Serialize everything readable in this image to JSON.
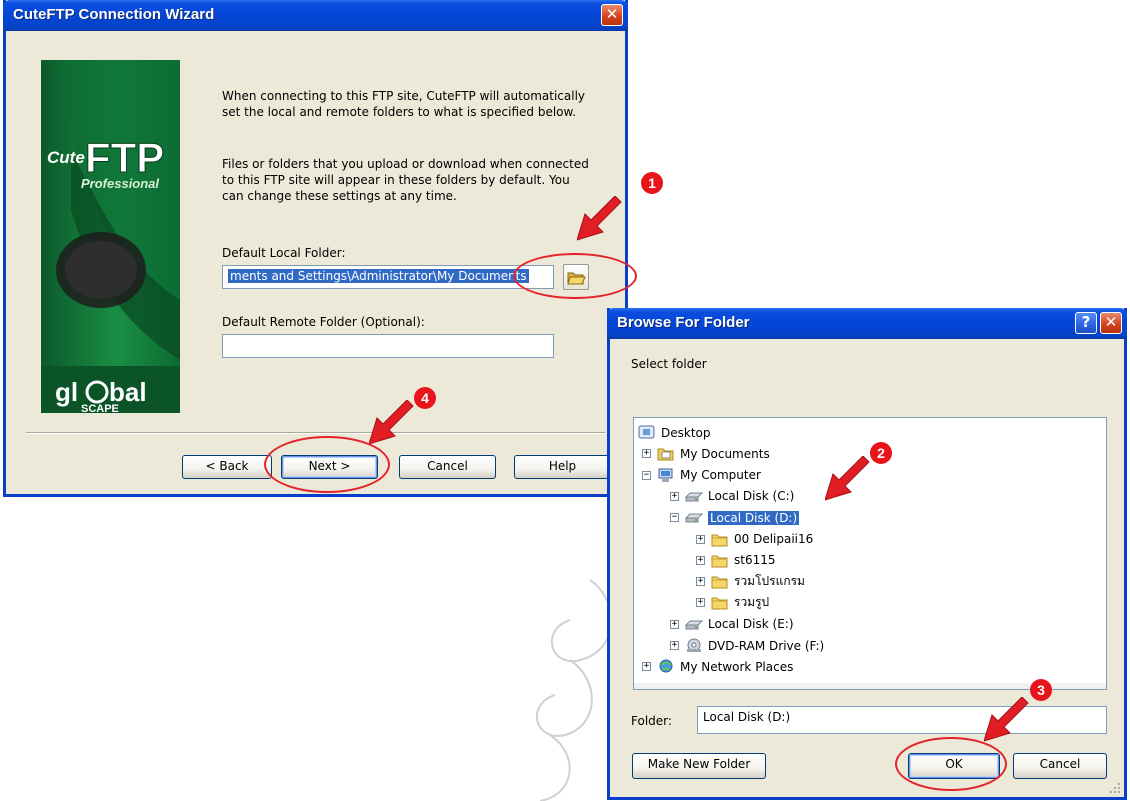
{
  "wizard": {
    "title": "CuteFTP Connection Wizard",
    "close_glyph": "✕",
    "logo_brand": "CuteFTP Professional",
    "logo_vendor": "globalSCAPE",
    "intro_para1": "When connecting to this FTP site, CuteFTP will automatically set the local and remote folders to what is specified below.",
    "intro_para2": "Files or folders that you upload or download when connected to this FTP site will appear in these folders by default. You can change these settings at any time.",
    "local_folder_label": "Default Local Folder:",
    "local_folder_value": "ments and Settings\\Administrator\\My Documents",
    "remote_folder_label": "Default Remote Folder (Optional):",
    "remote_folder_value": "",
    "buttons": {
      "back": "< Back",
      "next": "Next >",
      "cancel": "Cancel",
      "help": "Help"
    }
  },
  "browse": {
    "title": "Browse For Folder",
    "help_glyph": "?",
    "close_glyph": "✕",
    "prompt": "Select folder",
    "tree": [
      {
        "label": "Desktop",
        "icon": "desktop-icon"
      },
      {
        "label": "My Documents",
        "icon": "folder-docs-icon",
        "expander": "+"
      },
      {
        "label": "My Computer",
        "icon": "computer-icon",
        "expander": "−"
      },
      {
        "label": "Local Disk (C:)",
        "icon": "drive-icon",
        "expander": "+"
      },
      {
        "label": "Local Disk (D:)",
        "icon": "drive-icon",
        "expander": "−",
        "selected": true
      },
      {
        "label": "00 Delipaii16",
        "icon": "folder-icon",
        "expander": "+"
      },
      {
        "label": "st6115",
        "icon": "folder-icon",
        "expander": "+"
      },
      {
        "label": "รวมโปรแกรม",
        "icon": "folder-icon",
        "expander": "+"
      },
      {
        "label": "รวมรูป",
        "icon": "folder-icon",
        "expander": "+"
      },
      {
        "label": "Local Disk (E:)",
        "icon": "drive-icon",
        "expander": "+"
      },
      {
        "label": "DVD-RAM Drive (F:)",
        "icon": "dvd-drive-icon",
        "expander": "+"
      },
      {
        "label": "My Network Places",
        "icon": "network-icon",
        "expander": "+"
      }
    ],
    "folder_label": "Folder:",
    "folder_value": "Local Disk (D:)",
    "buttons": {
      "new_folder": "Make New Folder",
      "ok": "OK",
      "cancel": "Cancel"
    }
  },
  "annotations": {
    "step1": "1",
    "step2": "2",
    "step3": "3",
    "step4": "4"
  },
  "colors": {
    "xp_blue": "#0546d8",
    "dialog_bg": "#ece9d8",
    "annotation_red": "#e5232a",
    "logo_green": "#127a3a",
    "selection": "#316ac5"
  }
}
